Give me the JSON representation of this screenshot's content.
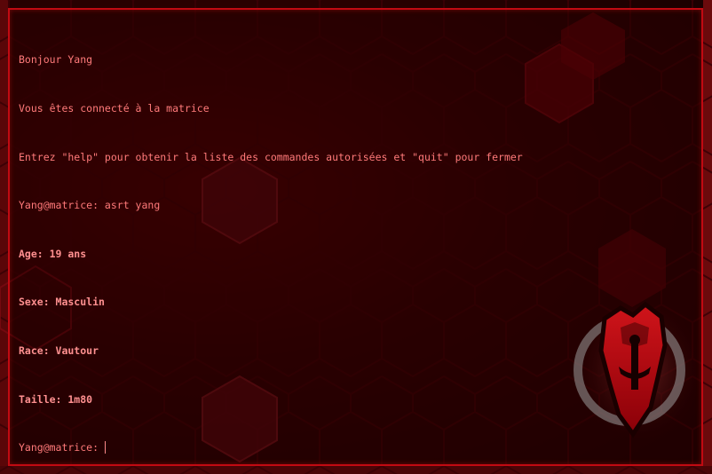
{
  "terminal": {
    "lines": [
      {
        "text": "Bonjour Yang",
        "bold": false
      },
      {
        "text": "Vous êtes connecté à la matrice",
        "bold": false
      },
      {
        "text": "Entrez \"help\" pour obtenir la liste des commandes autorisées et \"quit\" pour fermer",
        "bold": false
      },
      {
        "text": "Yang@matrice: asrt yang",
        "bold": false
      },
      {
        "text": "Age: 19 ans",
        "bold": true
      },
      {
        "text": "Sexe: Masculin",
        "bold": true
      },
      {
        "text": "Race: Vautour",
        "bold": true
      },
      {
        "text": "Taille: 1m80",
        "bold": true
      }
    ],
    "prompt": "Yang@matrice:",
    "input_value": ""
  },
  "emblem": {
    "icon": "clan-shield-emblem-icon"
  },
  "colors": {
    "frame": "#c10a12",
    "text": "#ff7a7a",
    "background": "#2a0000"
  }
}
